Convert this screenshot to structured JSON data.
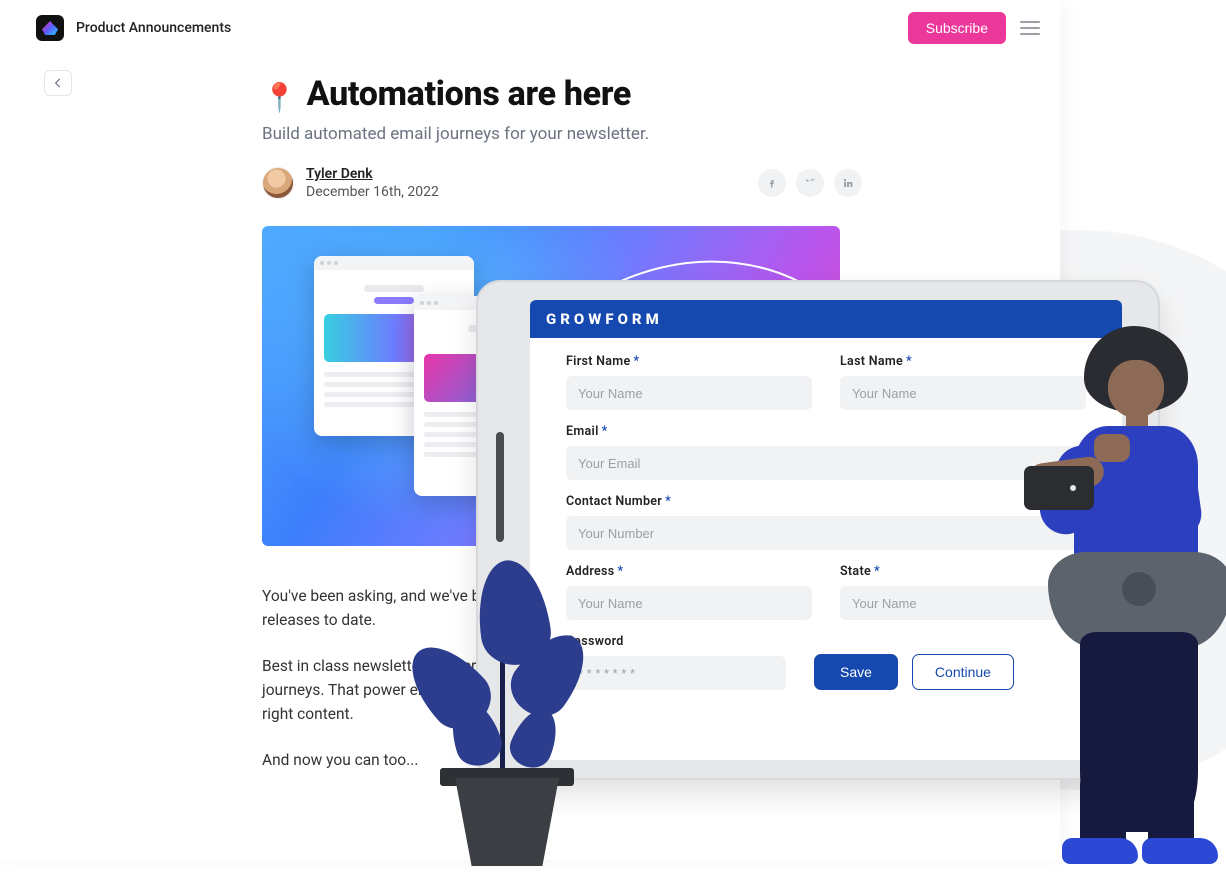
{
  "header": {
    "brand": "Product Announcements",
    "subscribe": "Subscribe"
  },
  "article": {
    "title": "Automations are here",
    "subtitle": "Build automated email journeys for your newsletter.",
    "author": "Tyler Denk",
    "date": "December 16th, 2022",
    "p1": "You've been asking, and we've been listening — today marks one of our biggest feature releases to date.",
    "p2": "Best in class newsletters understand the power of email sequences and automated journeys. That power enables them to send the right emails at the right time with the right content.",
    "p3": "And now you can too..."
  },
  "form": {
    "brand": "GROWFORM",
    "first_name_label": "First Name",
    "last_name_label": "Last Name",
    "email_label": "Email",
    "contact_label": "Contact  Number",
    "address_label": "Address",
    "state_label": "State",
    "password_label": "Password",
    "ph_name": "Your Name",
    "ph_email": "Your Email",
    "ph_number": "Your Number",
    "ph_pass": "* * * * * * *",
    "save": "Save",
    "continue": "Continue"
  }
}
